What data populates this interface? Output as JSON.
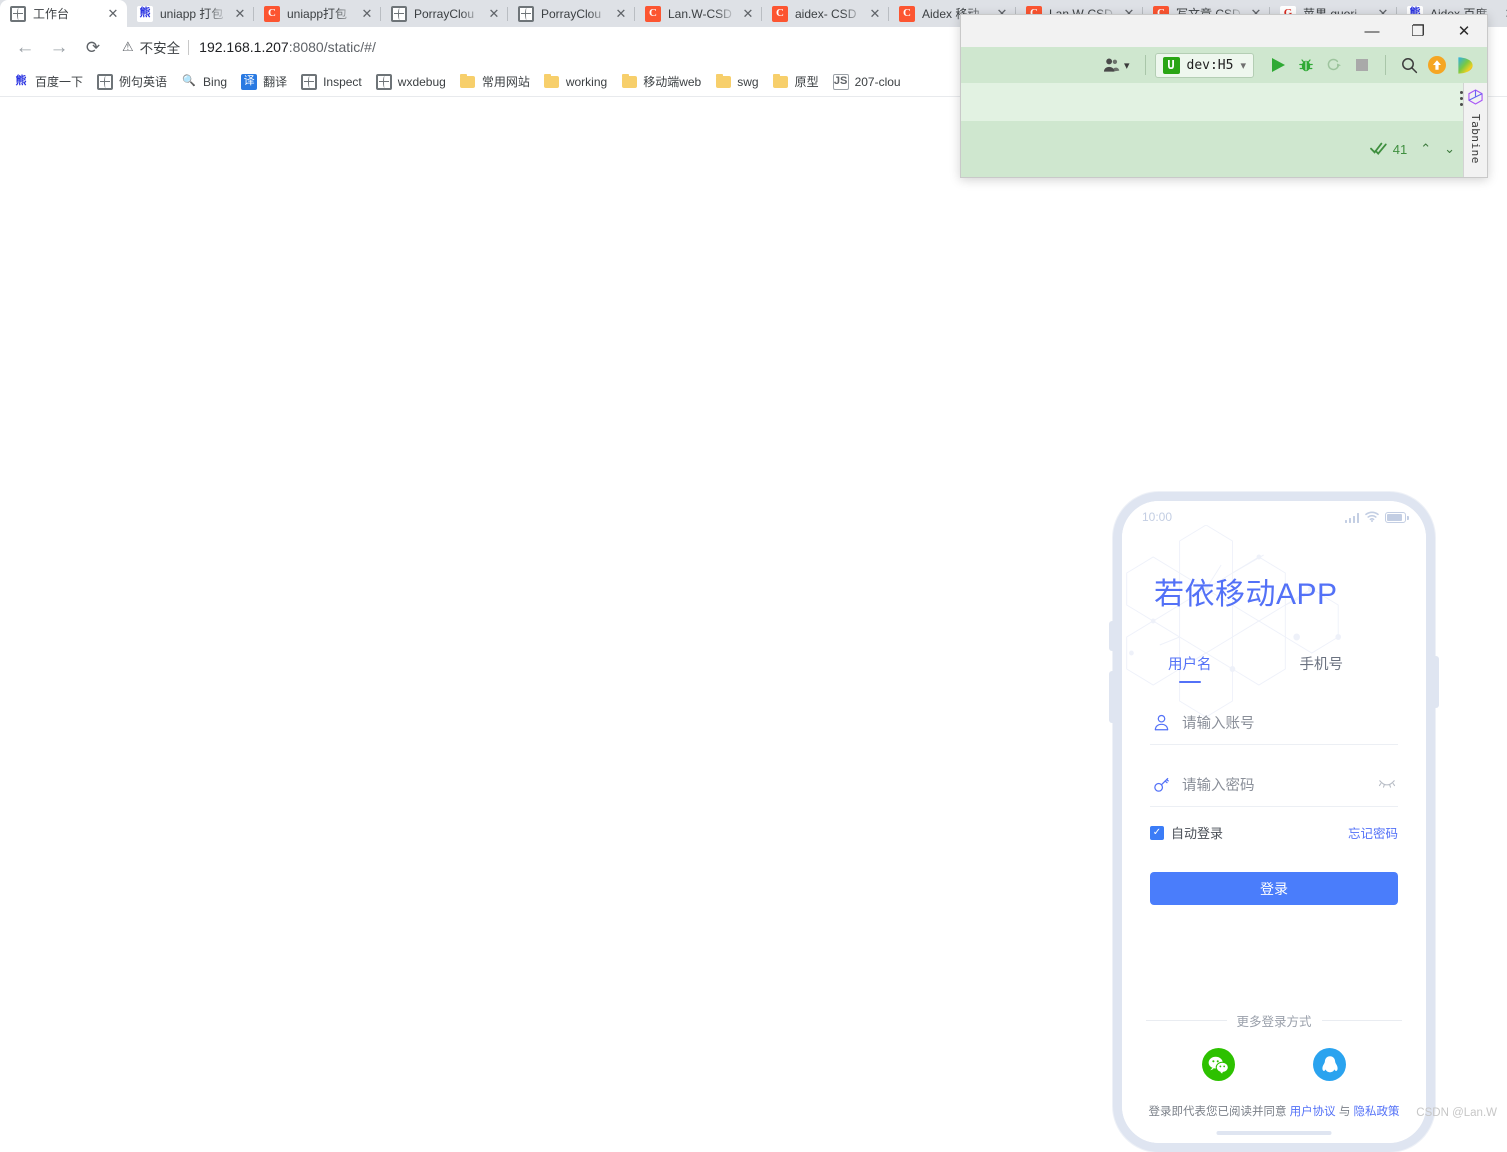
{
  "browser": {
    "tabs": [
      {
        "title": "工作台",
        "favicon": "globe-icon",
        "active": true
      },
      {
        "title": "uniapp 打包",
        "favicon": "baidu-icon",
        "active": false
      },
      {
        "title": "uniapp打包",
        "favicon": "csdn-icon",
        "active": false
      },
      {
        "title": "PorrayClou",
        "favicon": "globe-icon",
        "active": false
      },
      {
        "title": "PorrayClou",
        "favicon": "globe-icon",
        "active": false
      },
      {
        "title": "Lan.W-CSD",
        "favicon": "csdn-icon",
        "active": false
      },
      {
        "title": "aidex- CSD",
        "favicon": "csdn-icon",
        "active": false
      },
      {
        "title": "Aidex 移动",
        "favicon": "csdn-icon",
        "active": false
      },
      {
        "title": "Lan.W-CSD",
        "favicon": "csdn-icon",
        "active": false
      },
      {
        "title": "写文章 CSD",
        "favicon": "csdn-icon",
        "active": false
      },
      {
        "title": "苹果 quori",
        "favicon": "g-icon",
        "active": false
      },
      {
        "title": "Aidex 百度",
        "favicon": "baidu-icon",
        "active": false
      }
    ],
    "close_label": "✕",
    "nav": {
      "back_icon": "back-arrow-icon",
      "forward_icon": "forward-arrow-icon",
      "reload_icon": "reload-icon",
      "back_glyph": "←",
      "forward_glyph": "→",
      "reload_glyph": "⟳"
    },
    "omnibox": {
      "warn_glyph": "⚠",
      "security_label": "不安全",
      "url_host": "192.168.1.207",
      "url_rest": ":8080/static/#/"
    },
    "bookmarks": [
      {
        "label": "百度一下",
        "icon": "baidu-icon"
      },
      {
        "label": "例句英语",
        "icon": "globe-icon"
      },
      {
        "label": "Bing",
        "icon": "search-icon"
      },
      {
        "label": "翻译",
        "icon": "translate-icon"
      },
      {
        "label": "Inspect",
        "icon": "globe-icon"
      },
      {
        "label": "wxdebug",
        "icon": "globe-icon"
      },
      {
        "label": "常用网站",
        "icon": "folder-icon"
      },
      {
        "label": "working",
        "icon": "folder-icon"
      },
      {
        "label": "移动端web",
        "icon": "folder-icon"
      },
      {
        "label": "swg",
        "icon": "folder-icon"
      },
      {
        "label": "原型",
        "icon": "folder-icon"
      },
      {
        "label": "207-clou",
        "icon": "js-icon"
      }
    ]
  },
  "phone": {
    "status": {
      "time": "10:00",
      "signal_icon": "signal-bars-icon",
      "wifi_icon": "wifi-icon",
      "battery_icon": "battery-icon"
    },
    "app_title": "若依移动APP",
    "login_tabs": [
      {
        "label": "用户名",
        "active": true
      },
      {
        "label": "手机号",
        "active": false
      }
    ],
    "username_field": {
      "icon": "user-icon",
      "placeholder": "请输入账号",
      "value": ""
    },
    "password_field": {
      "icon": "key-icon",
      "placeholder": "请输入密码",
      "value": "",
      "toggle_icon": "eye-closed-icon"
    },
    "auto_login": {
      "label": "自动登录",
      "checked": true,
      "check_glyph": "✓"
    },
    "forgot_password": "忘记密码",
    "login_button": "登录",
    "more_login_label": "更多登录方式",
    "socials": [
      {
        "name": "wechat-icon",
        "color": "#2dc100"
      },
      {
        "name": "qq-icon",
        "color": "#2aa3ef"
      }
    ],
    "agreement": {
      "prefix": "登录即代表您已阅读并同意 ",
      "user_agreement": "用户协议",
      "middle": " 与 ",
      "privacy_policy": "隐私政策"
    }
  },
  "hbuilderx": {
    "window_controls": {
      "minimize": "—",
      "restore": "❐",
      "close": "✕"
    },
    "user_icon": "user-account-icon",
    "user_chevron": "▾",
    "run_target": {
      "logo": "U",
      "label": "dev:H5",
      "chevron": "▾"
    },
    "toolbar_icons": [
      {
        "name": "run-icon",
        "glyph": "▶"
      },
      {
        "name": "debug-bug-icon",
        "glyph": "🐞"
      },
      {
        "name": "restart-icon",
        "glyph": "↻"
      },
      {
        "name": "stop-icon",
        "glyph": "■"
      },
      {
        "name": "search-icon",
        "glyph": "🔍"
      },
      {
        "name": "upload-icon",
        "glyph": "↑"
      },
      {
        "name": "play-color-icon",
        "glyph": "▶"
      }
    ],
    "kebab_icon": "more-options-icon",
    "status": {
      "check_icon": "double-check-icon",
      "count": "41",
      "up_chevron": "⌃",
      "down_chevron": "⌄"
    },
    "tabnine": {
      "label": "Tabnine",
      "icon": "tabnine-cube-icon"
    }
  },
  "watermark": "CSDN @Lan.W"
}
